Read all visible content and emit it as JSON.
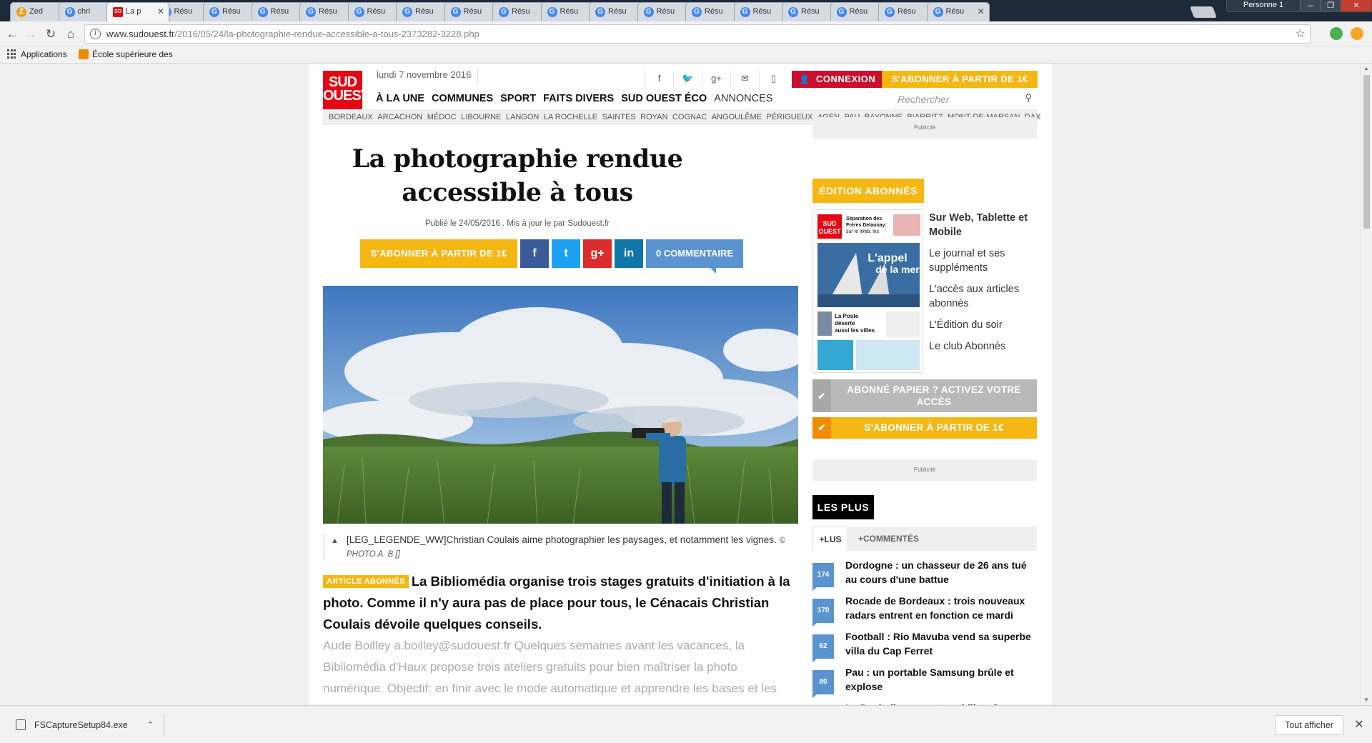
{
  "browser": {
    "tabs": [
      {
        "title": "Zed",
        "favicon": "zed-icon",
        "color": "#e8a020"
      },
      {
        "title": "chri",
        "favicon": "google-icon",
        "color": "#4285f4"
      },
      {
        "title": "La p",
        "favicon": "sudouest-icon",
        "color": "#e30613",
        "active": true
      },
      {
        "title": "Résu",
        "favicon": "google-icon",
        "color": "#4285f4"
      },
      {
        "title": "Résu",
        "favicon": "google-icon",
        "color": "#4285f4"
      },
      {
        "title": "Résu",
        "favicon": "google-icon",
        "color": "#4285f4"
      },
      {
        "title": "Résu",
        "favicon": "google-icon",
        "color": "#4285f4"
      },
      {
        "title": "Résu",
        "favicon": "google-icon",
        "color": "#4285f4"
      },
      {
        "title": "Résu",
        "favicon": "google-icon",
        "color": "#4285f4"
      },
      {
        "title": "Résu",
        "favicon": "google-icon",
        "color": "#4285f4"
      },
      {
        "title": "Résu",
        "favicon": "google-icon",
        "color": "#4285f4"
      },
      {
        "title": "Résu",
        "favicon": "google-icon",
        "color": "#4285f4"
      },
      {
        "title": "Résu",
        "favicon": "google-icon",
        "color": "#4285f4"
      },
      {
        "title": "Résu",
        "favicon": "google-icon",
        "color": "#4285f4"
      },
      {
        "title": "Résu",
        "favicon": "google-icon",
        "color": "#4285f4"
      },
      {
        "title": "Résu",
        "favicon": "google-icon",
        "color": "#4285f4"
      },
      {
        "title": "Résu",
        "favicon": "google-icon",
        "color": "#4285f4"
      },
      {
        "title": "Résu",
        "favicon": "google-icon",
        "color": "#4285f4"
      },
      {
        "title": "Résu",
        "favicon": "google-icon",
        "color": "#4285f4"
      },
      {
        "title": "Résu",
        "favicon": "google-icon",
        "color": "#4285f4"
      }
    ],
    "profile": "Personne 1",
    "url_host": "www.sudouest.fr",
    "url_path": "/2016/05/24/la-photographie-rendue-accessible-a-tous-2373282-3228.php",
    "bookmarks": [
      {
        "label": "Applications",
        "icon": "apps-grid-icon"
      },
      {
        "label": "École supérieure des",
        "icon": "bookmark-folder-icon"
      }
    ]
  },
  "site": {
    "logo_line1": "SUD",
    "logo_line2": "OUEST",
    "date": "lundi 7 novembre 2016",
    "social_icons": [
      "facebook-icon",
      "twitter-icon",
      "googleplus-icon",
      "mail-icon",
      "mobile-icon"
    ],
    "connexion": "CONNEXION",
    "subscribe_top": "S'ABONNER À PARTIR DE 1€",
    "nav": [
      "À LA UNE",
      "COMMUNES",
      "SPORT",
      "FAITS DIVERS",
      "SUD OUEST ÉCO",
      "ANNONCES"
    ],
    "search_placeholder": "Rechercher",
    "cities": [
      "BORDEAUX",
      "ARCACHON",
      "MÉDOC",
      "LIBOURNE",
      "LANGON",
      "LA ROCHELLE",
      "SAINTES",
      "ROYAN",
      "COGNAC",
      "ANGOULÊME",
      "PÉRIGUEUX",
      "AGEN",
      "PAU",
      "BAYONNE",
      "BIARRITZ",
      "MONT-DE-MARSAN",
      "DAX"
    ]
  },
  "article": {
    "title": "La photographie rendue accessible à tous",
    "meta": "Publié le 24/05/2016 . Mis à jour le par Sudouest.fr",
    "subscribe_btn": "S'ABONNER À PARTIR DE 1€",
    "share": [
      {
        "name": "facebook-share-button",
        "glyph": "f",
        "color": "#3b5998"
      },
      {
        "name": "twitter-share-button",
        "glyph": "t",
        "color": "#1da1f2"
      },
      {
        "name": "googleplus-share-button",
        "glyph": "g+",
        "color": "#dd2c2c"
      },
      {
        "name": "linkedin-share-button",
        "glyph": "in",
        "color": "#0e76a8"
      }
    ],
    "comments_btn": "0 COMMENTAIRE",
    "caption": "[LEG_LEGENDE_WW]Christian Coulais aime photographier les paysages, et notamment les vignes.",
    "caption_credit": "© PHOTO A. B.[]",
    "badge": "ARTICLE ABONNÉS",
    "lead": "La Bibliomédia organise trois stages gratuits d'initiation à la photo. Comme il n'y aura pas de place pour tous, le Cénacais Christian Coulais dévoile quelques conseils.",
    "body": "Aude Boilley a.boilley@sudouest.fr Quelques semaines avant les vacances, la Bibliomédia d'Haux propose trois ateliers gratuits pour bien maîtriser la photo numérique. Objectif: en finir avec le mode automatique et apprendre les bases et les"
  },
  "sidebar": {
    "pub_label": "Publicité",
    "edition_title": "ÉDITION ABONNÉS",
    "edition_items": [
      {
        "text": "Sur Web, Tablette et Mobile",
        "bold": true
      },
      {
        "text": "Le journal et ses suppléments"
      },
      {
        "text": "L'accès aux articles abonnés"
      },
      {
        "text": "L'Édition du soir"
      },
      {
        "text": "Le club Abonnés"
      }
    ],
    "cover": {
      "headline1": "Séparation des Frères Delaunay: sur le Web, les fans en émoi",
      "headline2": "L'appel de la mer",
      "headline3": "La Poste déserte aussi les villes"
    },
    "btn_paper": "ABONNÉ PAPIER ? ACTIVEZ VOTRE ACCÈS",
    "btn_subscribe": "S'ABONNER À PARTIR DE 1€",
    "lesplus_title": "LES PLUS",
    "tabs": [
      "+LUS",
      "+COMMENTÉS"
    ],
    "most_read": [
      {
        "count": "174",
        "title": "Dordogne : un chasseur de 26 ans tué au cours d'une battue"
      },
      {
        "count": "170",
        "title": "Rocade de Bordeaux : trois nouveaux radars entrent en fonction ce mardi"
      },
      {
        "count": "62",
        "title": "Football : Rio Mavuba vend sa superbe villa du Cap Ferret"
      },
      {
        "count": "80",
        "title": "Pau : un portable Samsung brûle et explose"
      },
      {
        "count": "",
        "title": "La Rochelle : un automobiliste fonce"
      }
    ]
  },
  "downloads": {
    "file": "FSCaptureSetup84.exe",
    "show_all": "Tout afficher"
  }
}
